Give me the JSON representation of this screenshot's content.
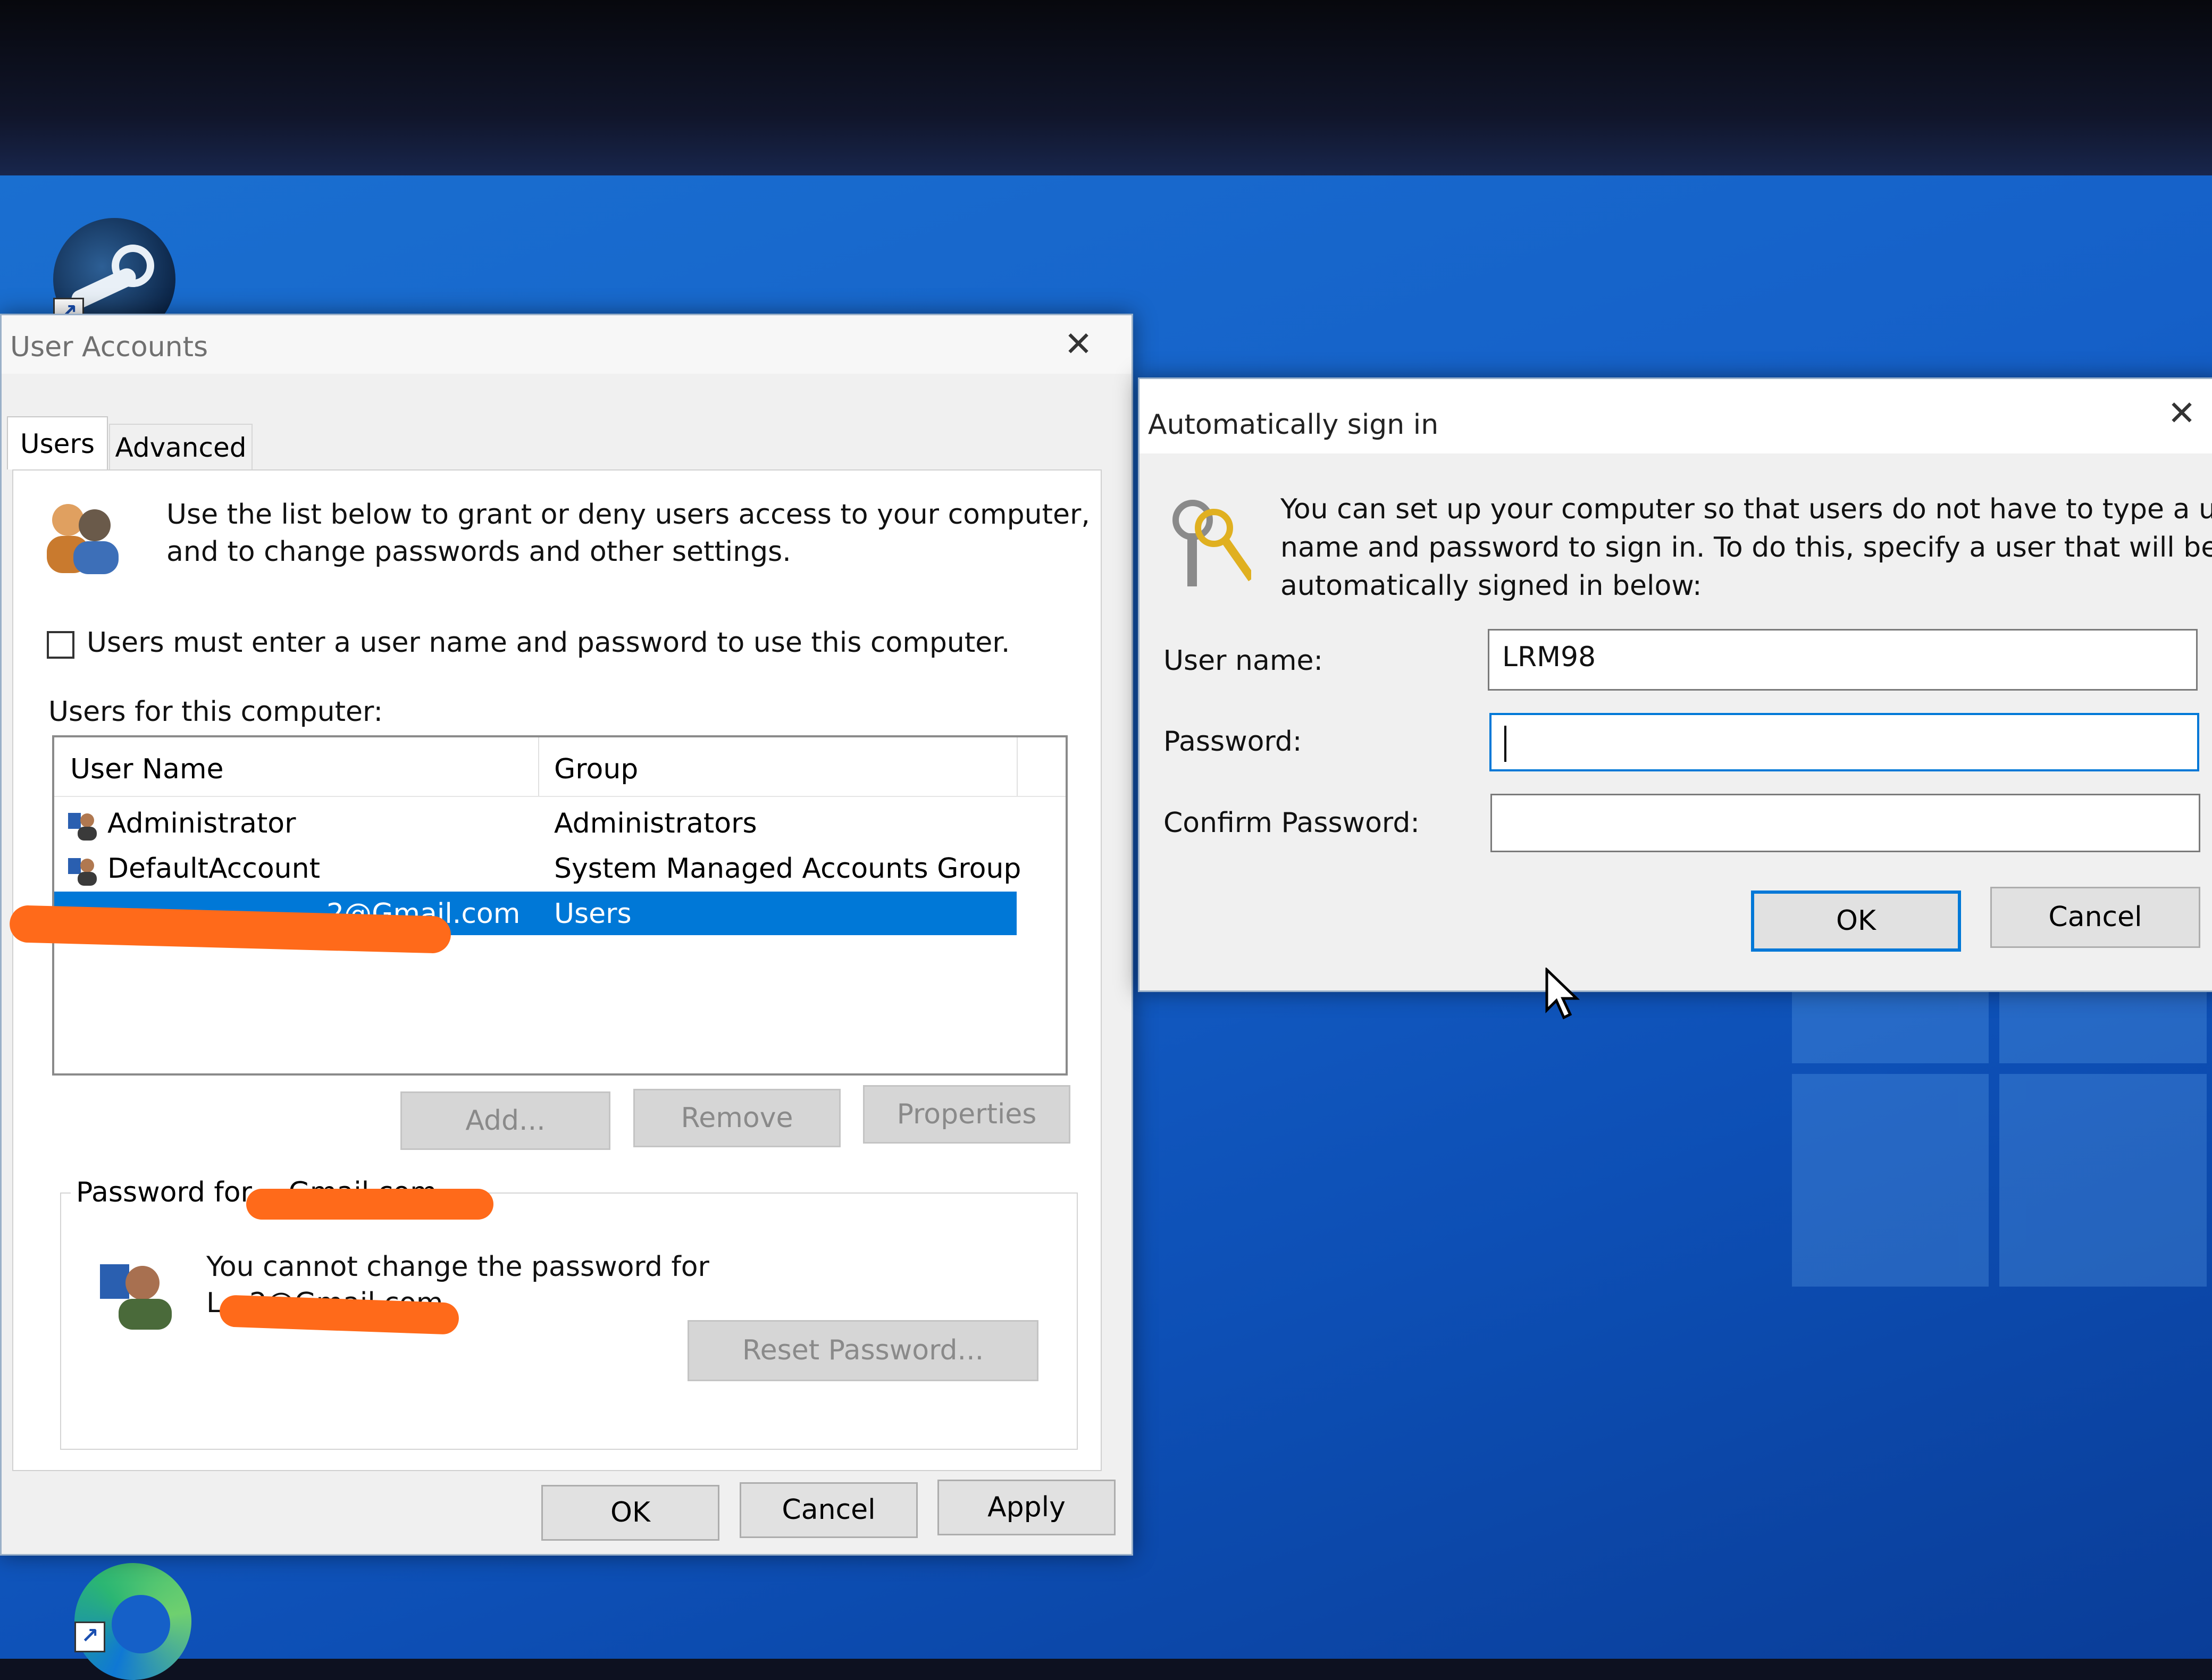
{
  "user_accounts": {
    "title": "User Accounts",
    "tabs": [
      {
        "label": "Users"
      },
      {
        "label": "Advanced"
      }
    ],
    "intro_text_line1": "Use the list below to grant or deny users access to your computer,",
    "intro_text_line2": "and to change passwords and other settings.",
    "checkbox_label": "Users must enter a user name and password to use this computer.",
    "users_label": "Users for this computer:",
    "columns": {
      "user_name": "User Name",
      "group": "Group"
    },
    "rows": [
      {
        "name": "Administrator",
        "group": "Administrators"
      },
      {
        "name": "DefaultAccount",
        "group": "System Managed Accounts Group"
      },
      {
        "name": "…2@Gmail.com",
        "group": "Users"
      }
    ],
    "buttons": {
      "add": "Add...",
      "remove": "Remove",
      "properties": "Properties"
    },
    "password_group_label": "Password for …Gmail.com",
    "password_text_line1": "You cannot change the password for",
    "password_text_line2": "L…2@Gmail.com.",
    "reset_password": "Reset Password...",
    "footer": {
      "ok": "OK",
      "cancel": "Cancel",
      "apply": "Apply"
    }
  },
  "auto_sign_in": {
    "title": "Automatically sign in",
    "desc_line1": "You can set up your computer so that users do not have to type a user",
    "desc_line2": "name and password to sign in. To do this, specify a user that will be",
    "desc_line3": "automatically signed in below:",
    "username_label": "User name:",
    "username_value": "LRM98",
    "password_label": "Password:",
    "confirm_label": "Confirm Password:",
    "ok": "OK",
    "cancel": "Cancel"
  },
  "colors": {
    "selection": "#0078d7",
    "redaction": "#ff6a1a",
    "desktop": "#1560c8"
  }
}
